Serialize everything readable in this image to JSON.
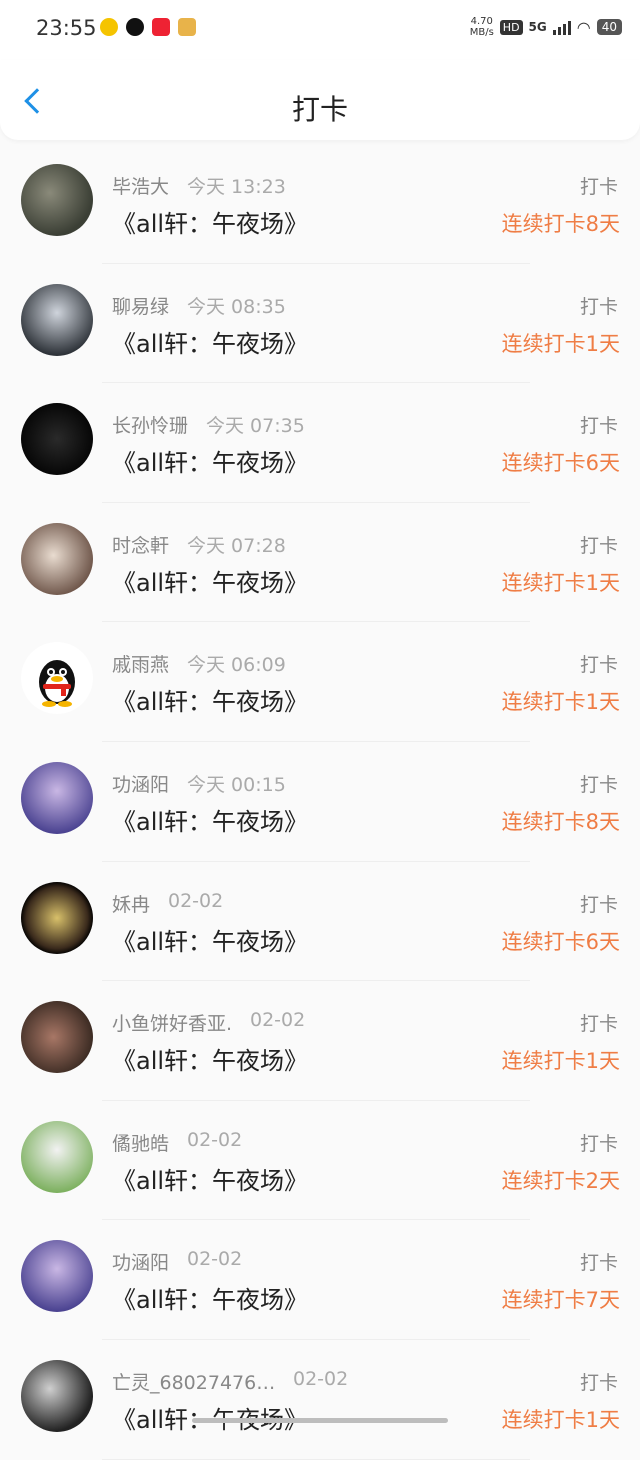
{
  "status": {
    "time": "23:55",
    "speed_value": "4.70",
    "speed_unit": "MB/s",
    "hd": "HD",
    "network": "5G",
    "battery": "40"
  },
  "header": {
    "title": "打卡",
    "back_icon": "chevron-left-icon"
  },
  "accent_color": "#ef7d45",
  "rows": [
    {
      "name": "毕浩大",
      "date": "今天 13:23",
      "book": "《all轩：午夜场》",
      "action": "打卡",
      "streak": "连续打卡8天",
      "avatar": "photo-avatar"
    },
    {
      "name": "聊易绿",
      "date": "今天 08:35",
      "book": "《all轩：午夜场》",
      "action": "打卡",
      "streak": "连续打卡1天",
      "avatar": "photo-avatar"
    },
    {
      "name": "长孙怜珊",
      "date": "今天 07:35",
      "book": "《all轩：午夜场》",
      "action": "打卡",
      "streak": "连续打卡6天",
      "avatar": "photo-avatar"
    },
    {
      "name": "时念軒",
      "date": "今天 07:28",
      "book": "《all轩：午夜场》",
      "action": "打卡",
      "streak": "连续打卡1天",
      "avatar": "photo-avatar"
    },
    {
      "name": "戚雨燕",
      "date": "今天 06:09",
      "book": "《all轩：午夜场》",
      "action": "打卡",
      "streak": "连续打卡1天",
      "avatar": "qq-penguin-avatar"
    },
    {
      "name": "功涵阳",
      "date": "今天 00:15",
      "book": "《all轩：午夜场》",
      "action": "打卡",
      "streak": "连续打卡8天",
      "avatar": "anime-avatar"
    },
    {
      "name": "姀冉",
      "date": "02-02",
      "book": "《all轩：午夜场》",
      "action": "打卡",
      "streak": "连续打卡6天",
      "avatar": "photo-avatar"
    },
    {
      "name": "小鱼饼好香亚.",
      "date": "02-02",
      "book": "《all轩：午夜场》",
      "action": "打卡",
      "streak": "连续打卡1天",
      "avatar": "photo-avatar"
    },
    {
      "name": "僪驰皓",
      "date": "02-02",
      "book": "《all轩：午夜场》",
      "action": "打卡",
      "streak": "连续打卡2天",
      "avatar": "photo-avatar"
    },
    {
      "name": "功涵阳",
      "date": "02-02",
      "book": "《all轩：午夜场》",
      "action": "打卡",
      "streak": "连续打卡7天",
      "avatar": "anime-avatar"
    },
    {
      "name": "亡灵_68027476…",
      "date": "02-02",
      "book": "《all轩：午夜场》",
      "action": "打卡",
      "streak": "连续打卡1天",
      "avatar": "photo-avatar"
    }
  ]
}
